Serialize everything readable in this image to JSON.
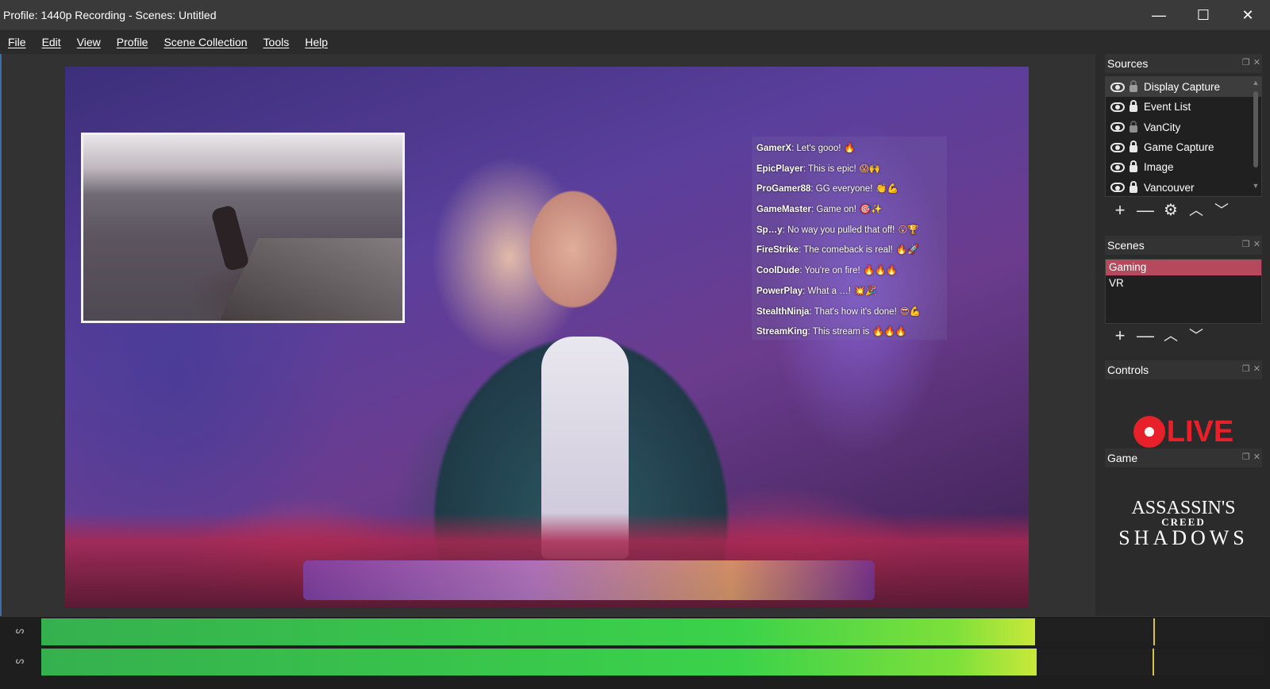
{
  "window": {
    "title": "Profile: 1440p Recording - Scenes: Untitled",
    "minimize_glyph": "—",
    "maximize_glyph": "☐",
    "close_glyph": "✕"
  },
  "menu": [
    "File",
    "Edit",
    "View",
    "Profile",
    "Scene Collection",
    "Tools",
    "Help"
  ],
  "preview": {
    "chat": [
      {
        "user": "GamerX",
        "text": ": Let's gooo!",
        "emoji": "🔥"
      },
      {
        "user": "EpicPlayer",
        "text": ": This is epic!",
        "emoji": "😱🙌"
      },
      {
        "user": "ProGamer88",
        "text": ": GG everyone!",
        "emoji": "👏💪"
      },
      {
        "user": "GameMaster",
        "text": ": Game on!",
        "emoji": "🎯✨"
      },
      {
        "user": "Sp…y",
        "text": ": No way you pulled that off!",
        "emoji": "😮🏆"
      },
      {
        "user": "FireStrike",
        "text": ": The comeback is real!",
        "emoji": "🔥🚀"
      },
      {
        "user": "CoolDude",
        "text": ": You're on fire!",
        "emoji": "🔥🔥🔥"
      },
      {
        "user": "PowerPlay",
        "text": ": What a …!",
        "emoji": "💥🎉"
      },
      {
        "user": "StealthNinja",
        "text": ": That's how it's done!",
        "emoji": "😎💪"
      },
      {
        "user": "StreamKing",
        "text": ": This stream is",
        "emoji": "🔥🔥🔥"
      }
    ]
  },
  "sources": {
    "header": "Sources",
    "items": [
      {
        "label": "Display Capture",
        "selected": true,
        "locked": false
      },
      {
        "label": "Event List",
        "selected": false,
        "locked": true
      },
      {
        "label": "VanCity",
        "selected": false,
        "locked": false
      },
      {
        "label": "Game Capture",
        "selected": false,
        "locked": true
      },
      {
        "label": "Image",
        "selected": false,
        "locked": true
      },
      {
        "label": "Vancouver",
        "selected": false,
        "locked": true
      }
    ],
    "toolbar": {
      "add": "+",
      "remove": "—",
      "settings": "⚙",
      "up": "︿",
      "down": "﹀"
    }
  },
  "scenes": {
    "header": "Scenes",
    "items": [
      {
        "label": "Gaming",
        "selected": true
      },
      {
        "label": "VR",
        "selected": false
      }
    ],
    "toolbar": {
      "add": "+",
      "remove": "—",
      "up": "︿",
      "down": "﹀"
    }
  },
  "controls": {
    "header": "Controls",
    "live_label": "LIVE"
  },
  "game": {
    "header": "Game",
    "logo_line1": "ASSASSIN'S",
    "logo_line2": "CREED",
    "logo_line3": "SHADOWS"
  },
  "mixer": {
    "channels": [
      {
        "icon": "ᔕ",
        "level": 0.813,
        "peak": 0.91
      },
      {
        "icon": "ᔕ",
        "level": 0.814,
        "peak": 0.909
      }
    ]
  },
  "colors": {
    "accent_selected_scene": "#b5495e",
    "live_red": "#e8202a",
    "meter_green": "#3bd24a"
  }
}
